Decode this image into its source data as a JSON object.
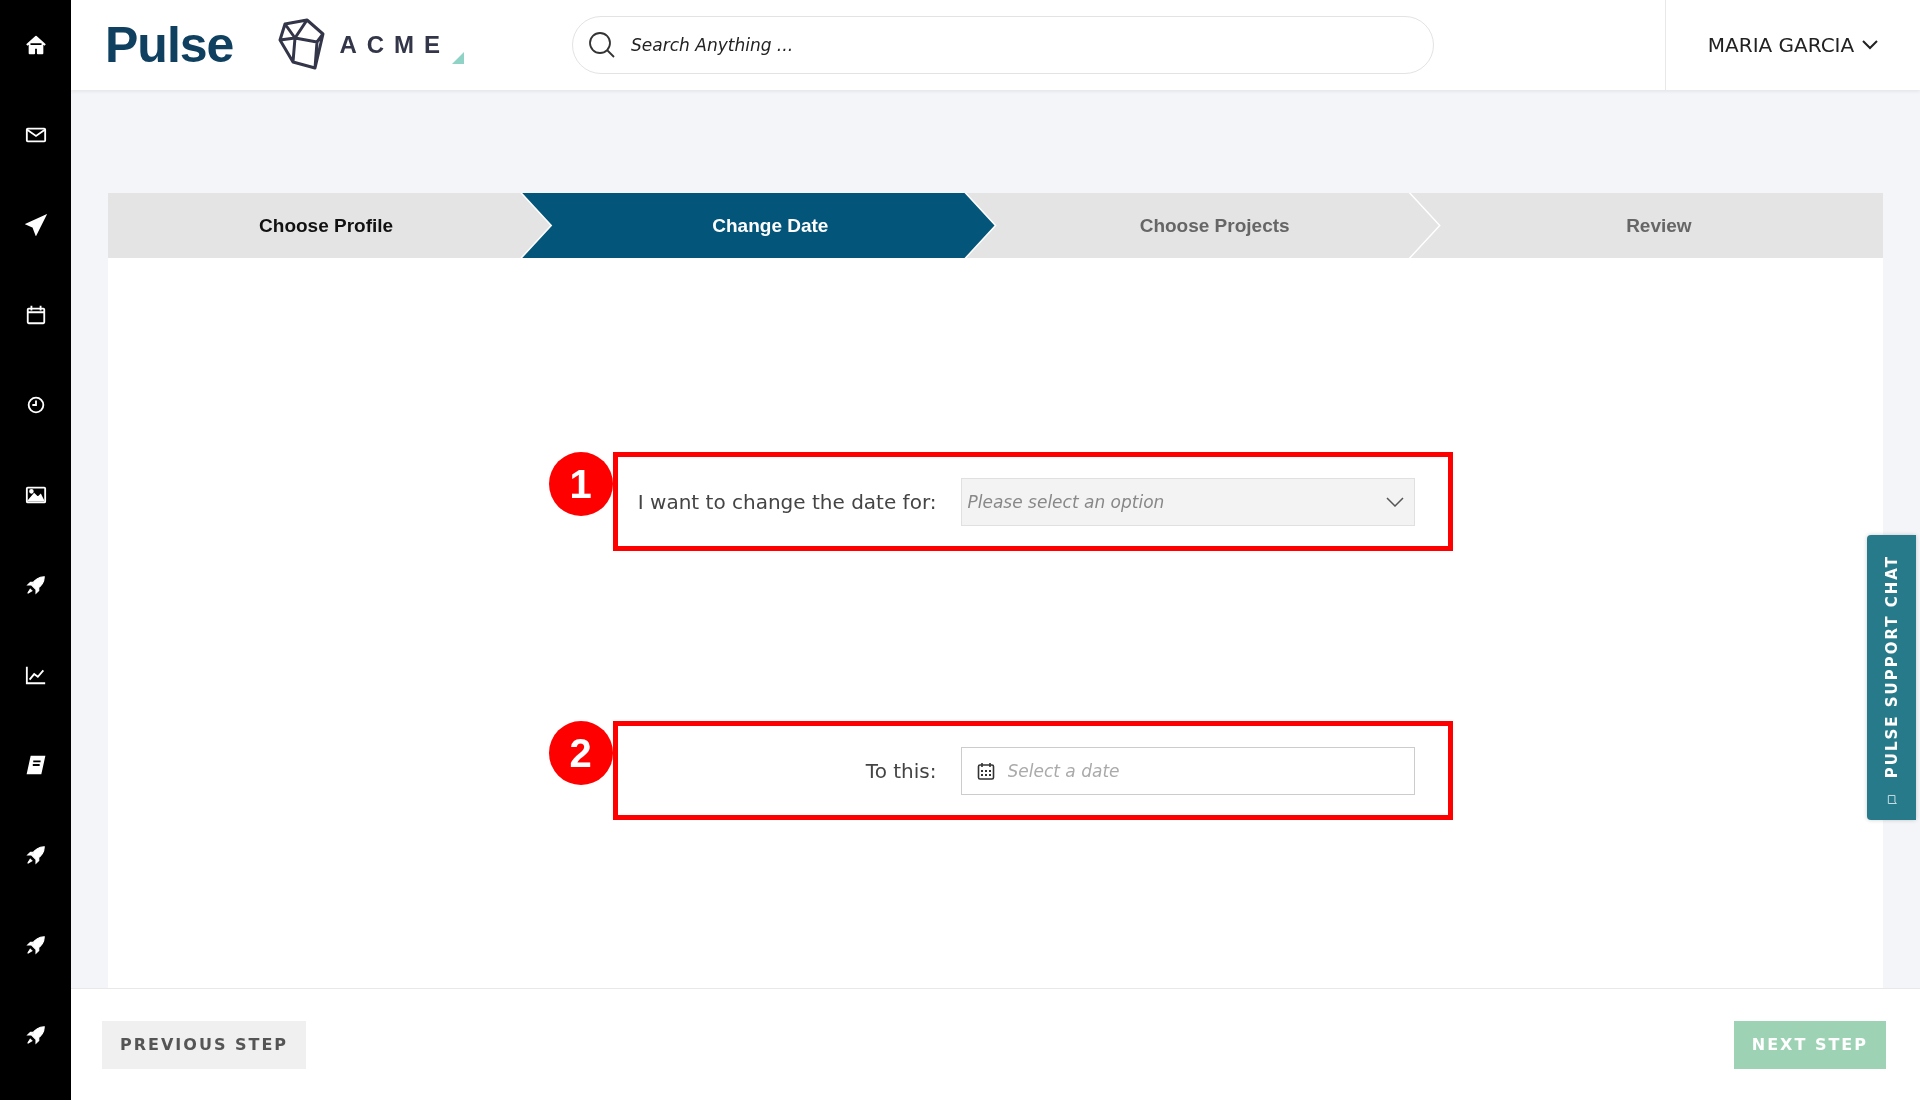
{
  "header": {
    "logo": "Pulse",
    "partner_logo": "ACME",
    "search": {
      "placeholder": "Search Anything ..."
    },
    "user_menu": "MARIA GARCIA"
  },
  "steps": [
    {
      "label": "Choose Profile",
      "selected": false,
      "done": true
    },
    {
      "label": "Change Date",
      "selected": true,
      "done": false
    },
    {
      "label": "Choose Projects",
      "selected": false,
      "done": false
    },
    {
      "label": "Review",
      "selected": false,
      "done": false
    }
  ],
  "form": [
    {
      "marker": "1",
      "label": "I want to change the date for:",
      "kind": "select",
      "placeholder": "Please select an option"
    },
    {
      "marker": "2",
      "label": "To this:",
      "kind": "date",
      "placeholder": "Select a date"
    }
  ],
  "support_chat": "PULSE SUPPORT CHAT",
  "footer": {
    "previous": {
      "label": "PREVIOUS STEP",
      "disabled": false
    },
    "next": {
      "label": "NEXT STEP",
      "disabled": true
    }
  }
}
